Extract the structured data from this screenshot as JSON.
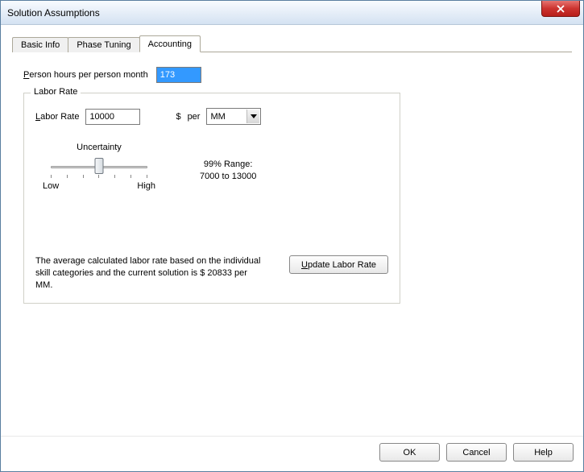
{
  "window": {
    "title": "Solution Assumptions"
  },
  "tabs": {
    "basic_info": "Basic Info",
    "phase_tuning": "Phase Tuning",
    "accounting": "Accounting"
  },
  "accounting": {
    "person_hours_label_prefix": "P",
    "person_hours_label_rest": "erson hours per person month",
    "person_hours_value": "173",
    "labor_rate_section": "Labor Rate",
    "labor_rate_label_prefix": "L",
    "labor_rate_label_rest": "abor Rate",
    "labor_rate_value": "10000",
    "currency": "$",
    "per": "per",
    "unit_selected": "MM",
    "uncertainty_label": "Uncertainty",
    "low_label": "Low",
    "high_label": "High",
    "range_title": "99% Range:",
    "range_values": "7000 to 13000",
    "description": "The average calculated labor rate based on the individual skill categories and the current solution is $ 20833 per MM.",
    "update_button": "Update Labor Rate"
  },
  "buttons": {
    "ok": "OK",
    "cancel": "Cancel",
    "help": "Help"
  }
}
